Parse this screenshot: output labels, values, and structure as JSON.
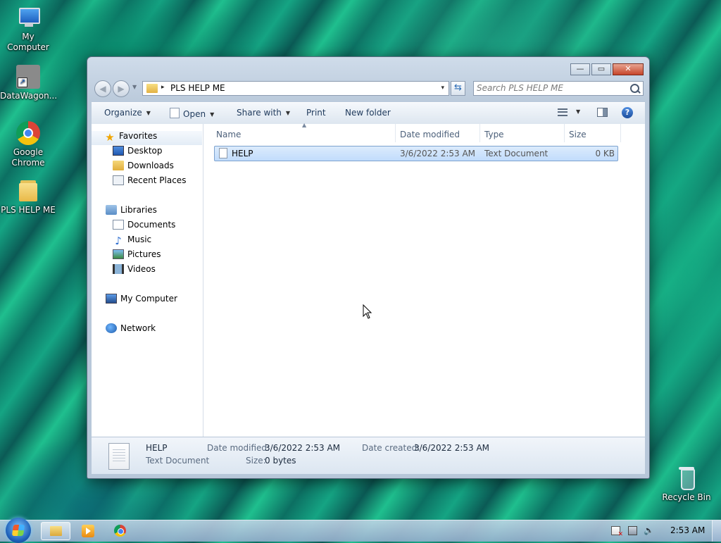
{
  "desktop": {
    "icons": [
      {
        "label": "My Computer",
        "icon": "computer-icon"
      },
      {
        "label": "DataWagon...",
        "icon": "shortcut-icon"
      },
      {
        "label": "Google Chrome",
        "icon": "chrome-icon"
      },
      {
        "label": "PLS HELP ME",
        "icon": "folder-icon"
      },
      {
        "label": "Recycle Bin",
        "icon": "recycle-bin-icon"
      }
    ]
  },
  "window": {
    "controls": {
      "minimize": "—",
      "maximize": "▭",
      "close": "✕"
    },
    "address": {
      "path": "PLS HELP ME",
      "separator": "▸",
      "dropdown": "▾"
    },
    "search": {
      "placeholder": "Search PLS HELP ME"
    },
    "toolbar": {
      "organize": "Organize",
      "open": "Open",
      "share_with": "Share with",
      "print": "Print",
      "new_folder": "New folder",
      "caret": "▼",
      "help": "?"
    },
    "nav_pane": {
      "favorites": "Favorites",
      "favorites_items": [
        "Desktop",
        "Downloads",
        "Recent Places"
      ],
      "libraries": "Libraries",
      "libraries_items": [
        "Documents",
        "Music",
        "Pictures",
        "Videos"
      ],
      "computer": "My Computer",
      "network": "Network"
    },
    "columns": {
      "name": "Name",
      "date_modified": "Date modified",
      "type": "Type",
      "size": "Size"
    },
    "files": [
      {
        "name": "HELP",
        "date_modified": "3/6/2022 2:53 AM",
        "type": "Text Document",
        "size": "0 KB"
      }
    ],
    "details": {
      "name": "HELP",
      "type": "Text Document",
      "date_modified_label": "Date modified:",
      "date_modified": "3/6/2022 2:53 AM",
      "date_created_label": "Date created:",
      "date_created": "3/6/2022 2:53 AM",
      "size_label": "Size:",
      "size": "0 bytes"
    }
  },
  "taskbar": {
    "clock": "2:53 AM",
    "apps": [
      "explorer-icon",
      "media-player-icon",
      "chrome-icon"
    ]
  }
}
